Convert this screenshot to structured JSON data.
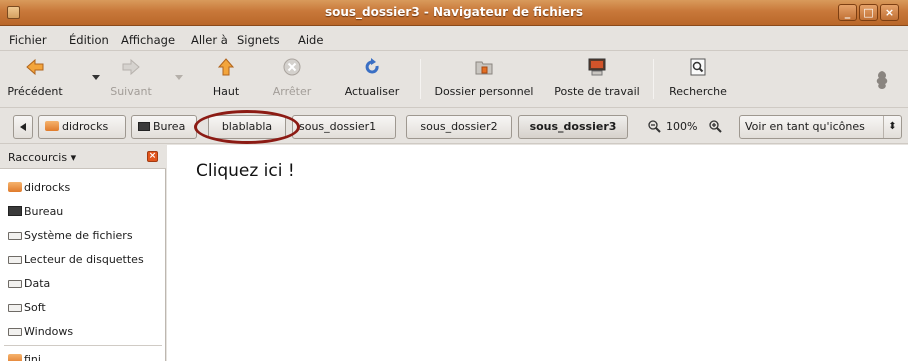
{
  "window": {
    "title": "sous_dossier3 - Navigateur de fichiers",
    "controls": [
      "_",
      "□",
      "×"
    ]
  },
  "menubar": [
    "Fichier",
    "Édition",
    "Affichage",
    "Aller à",
    "Signets",
    "Aide"
  ],
  "toolbar": {
    "back": "Précédent",
    "forward": "Suivant",
    "up": "Haut",
    "stop": "Arrêter",
    "reload": "Actualiser",
    "home": "Dossier personnel",
    "computer": "Poste de travail",
    "search": "Recherche"
  },
  "pathbar": {
    "items": [
      "didrocks",
      "Burea",
      "blablabla",
      "sous_dossier1",
      "sous_dossier2",
      "sous_dossier3"
    ],
    "zoom": "100%",
    "view_mode": "Voir en tant qu'icônes"
  },
  "sidebar": {
    "title": "Raccourcis",
    "items": [
      "didrocks",
      "Bureau",
      "Système de fichiers",
      "Lecteur de disquettes",
      "Data",
      "Soft",
      "Windows",
      "fini"
    ]
  },
  "main": {
    "hint": "Cliquez ici !"
  },
  "colors": {
    "titlebar": "#c8783a",
    "highlight_ellipse": "#8c1b14"
  }
}
